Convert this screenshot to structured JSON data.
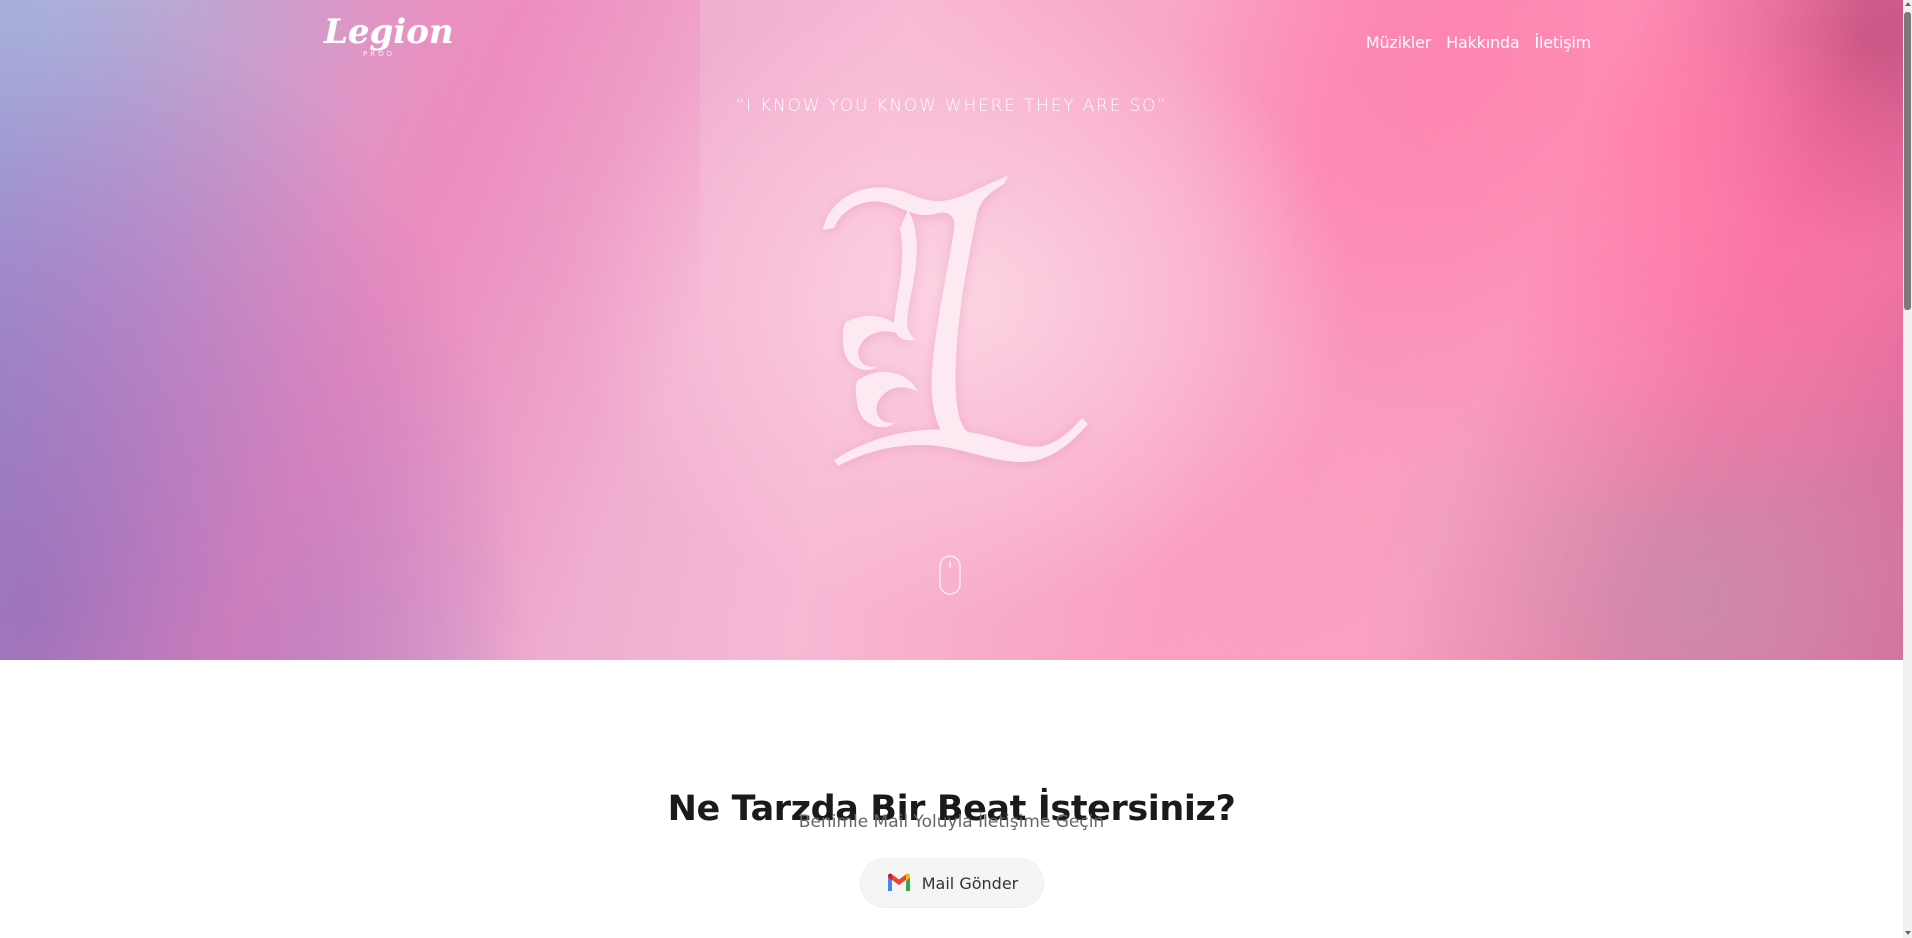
{
  "brand": {
    "logo_text": "Legion",
    "logo_sub": "PROD"
  },
  "nav": {
    "items": [
      {
        "label": "Müzikler"
      },
      {
        "label": "Hakkında"
      },
      {
        "label": "İletişim"
      }
    ]
  },
  "hero": {
    "quote": "“I KNOW YOU KNOW WHERE THEY ARE SO”",
    "emblem_letter": "L",
    "scroll_icon": "mouse-scroll-icon"
  },
  "contact": {
    "title": "Ne Tarzda Bir Beat İstersiniz?",
    "subtitle": "Benimle Mail Yoluyla İletişime Geçin",
    "button_label": "Mail Gönder",
    "button_icon": "gmail-icon"
  },
  "colors": {
    "hero_pink": "#f7b8d4",
    "hero_hot_pink": "#f77aa8",
    "hero_violet": "#a8a7d6",
    "text_dark": "#1a1a1a",
    "text_muted": "#666666",
    "button_bg": "#f5f5f5"
  }
}
